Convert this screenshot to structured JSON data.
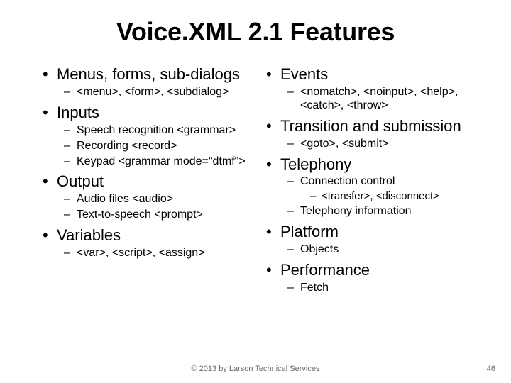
{
  "title": "Voice.XML 2.1 Features",
  "left": {
    "items": [
      {
        "label": "Menus, forms, sub-dialogs",
        "sub": [
          {
            "label": "<menu>, <form>, <subdialog>"
          }
        ]
      },
      {
        "label": "Inputs",
        "sub": [
          {
            "label": "Speech recognition <grammar>"
          },
          {
            "label": "Recording <record>"
          },
          {
            "label": "Keypad <grammar mode=\"dtmf\">"
          }
        ]
      },
      {
        "label": "Output",
        "sub": [
          {
            "label": "Audio files <audio>"
          },
          {
            "label": "Text-to-speech <prompt>"
          }
        ]
      },
      {
        "label": "Variables",
        "sub": [
          {
            "label": "<var>, <script>, <assign>"
          }
        ]
      }
    ]
  },
  "right": {
    "items": [
      {
        "label": "Events",
        "sub": [
          {
            "label": "<nomatch>, <noinput>, <help>, <catch>, <throw>"
          }
        ]
      },
      {
        "label": "Transition and submission",
        "sub": [
          {
            "label": "<goto>, <submit>"
          }
        ]
      },
      {
        "label": "Telephony",
        "sub": [
          {
            "label": "Connection control",
            "sub": [
              {
                "label": "<transfer>, <disconnect>"
              }
            ]
          },
          {
            "label": "Telephony information"
          }
        ]
      },
      {
        "label": "Platform",
        "sub": [
          {
            "label": "Objects"
          }
        ]
      },
      {
        "label": "Performance",
        "sub": [
          {
            "label": "Fetch"
          }
        ]
      }
    ]
  },
  "footer": "© 2013 by Larson Technical Services",
  "page": "46"
}
